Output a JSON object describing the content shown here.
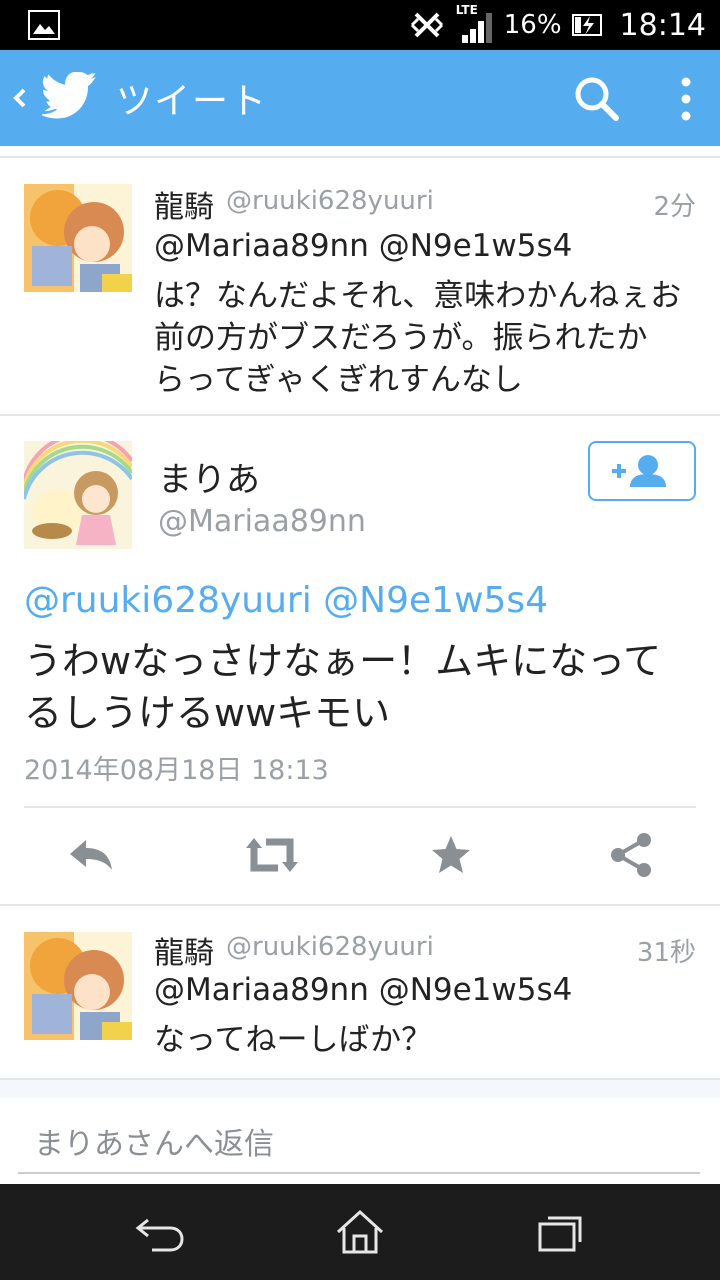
{
  "status_bar": {
    "network_label": "LTE",
    "battery_percent": "16%",
    "time": "18:14",
    "icons": [
      "image-notification-icon",
      "nfc-icon",
      "signal-icon",
      "battery-charging-icon"
    ]
  },
  "app_bar": {
    "title": "ツイート",
    "icons": [
      "back-chevron-icon",
      "twitter-bird-icon",
      "search-icon",
      "overflow-menu-icon"
    ],
    "color": "#55acee"
  },
  "tweets_before": [
    {
      "name": "龍騎",
      "handle": "@ruuki628yuuri",
      "time": "2分",
      "lines": [
        "@Mariaa89nn @N9e1w5s4",
        "は？なんだよそれ、意味わかんねぇお",
        "前の方がブスだろうが。振られたか",
        "らってぎゃくぎれすんなし"
      ]
    }
  ],
  "main_tweet": {
    "name": "まりあ",
    "handle": "@Mariaa89nn",
    "follow_icon": "follow-add-user-icon",
    "mentions": "@ruuki628yuuri @N9e1w5s4",
    "lines": [
      "うわwなっさけなぁー！ムキになって",
      "るしうけるwwキモい"
    ],
    "date": "2014年08月18日 18:13",
    "actions": [
      "reply-icon",
      "retweet-icon",
      "favorite-star-icon",
      "share-icon"
    ]
  },
  "tweets_after": [
    {
      "name": "龍騎",
      "handle": "@ruuki628yuuri",
      "time": "31秒",
      "lines": [
        "@Mariaa89nn @N9e1w5s4",
        "なってねーしばか？"
      ]
    }
  ],
  "reply": {
    "placeholder": "まりあさんへ返信"
  },
  "nav_bar": {
    "icons": [
      "back-nav-icon",
      "home-icon",
      "recent-apps-icon"
    ]
  },
  "colors": {
    "accent": "#55acee",
    "text": "#222222",
    "secondary": "#9aa0a6"
  }
}
